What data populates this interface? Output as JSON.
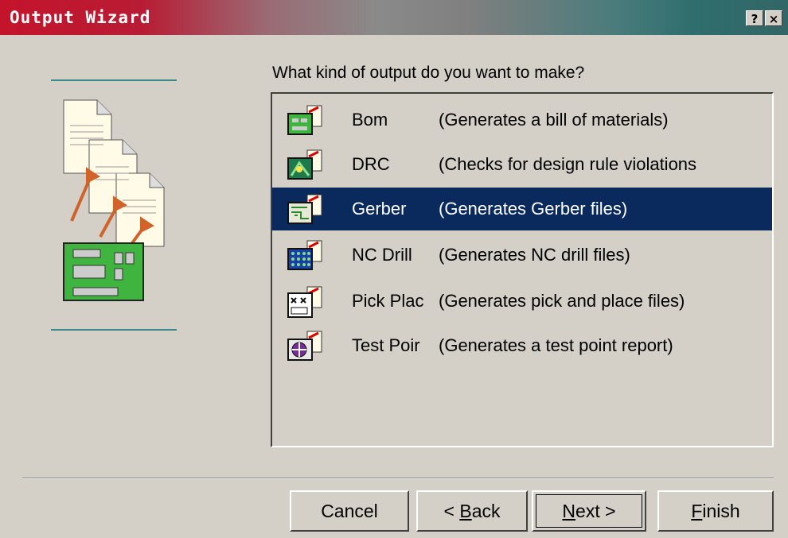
{
  "window": {
    "title": "Output Wizard",
    "help_glyph": "?",
    "close_glyph": "×"
  },
  "prompt": "What kind of output do you want to make?",
  "output_types": [
    {
      "name": "Bom",
      "description": "(Generates a bill of materials)",
      "icon": "bom-icon",
      "selected": false
    },
    {
      "name": "DRC",
      "description": "(Checks for design rule violations",
      "icon": "drc-icon",
      "selected": false
    },
    {
      "name": "Gerber",
      "description": "(Generates Gerber files)",
      "icon": "gerber-icon",
      "selected": true
    },
    {
      "name": "NC Drill",
      "description": "(Generates NC drill files)",
      "icon": "nc-drill-icon",
      "selected": false
    },
    {
      "name": "Pick Plac",
      "description": "(Generates pick and place files)",
      "icon": "pick-place-icon",
      "selected": false
    },
    {
      "name": "Test Poir",
      "description": "(Generates a test point report)",
      "icon": "test-point-icon",
      "selected": false
    }
  ],
  "buttons": {
    "cancel": "Cancel",
    "back_prefix": "< ",
    "back_mnemonic": "B",
    "back_rest": "ack",
    "next_mnemonic": "N",
    "next_rest": "ext >",
    "finish_mnemonic": "F",
    "finish_rest": "inish"
  },
  "colors": {
    "selection": "#0a2a5e",
    "dialog_face": "#d4d0c8"
  }
}
